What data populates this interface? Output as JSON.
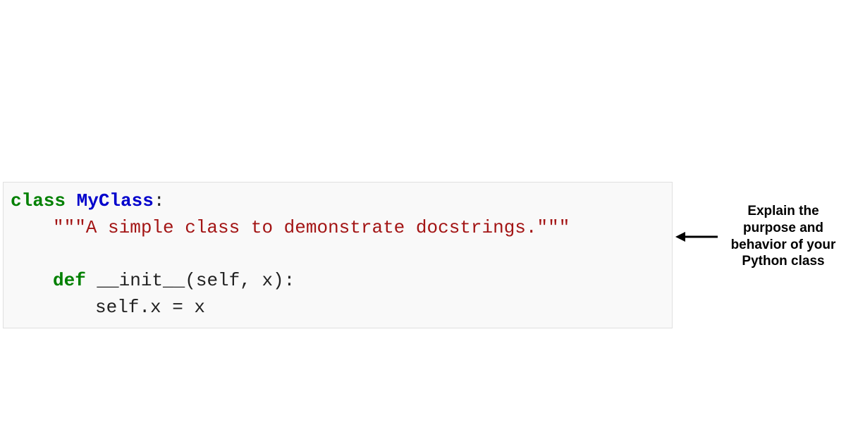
{
  "code": {
    "line1_kw": "class",
    "line1_name": " MyClass",
    "line1_colon": ":",
    "line2_doc": "\"\"\"A simple class to demonstrate docstrings.\"\"\"",
    "line4_kw": "def",
    "line4_rest": " __init__(self, x):",
    "line5": "self.x = x"
  },
  "annotation": {
    "text": "Explain the purpose and behavior of your Python class"
  }
}
